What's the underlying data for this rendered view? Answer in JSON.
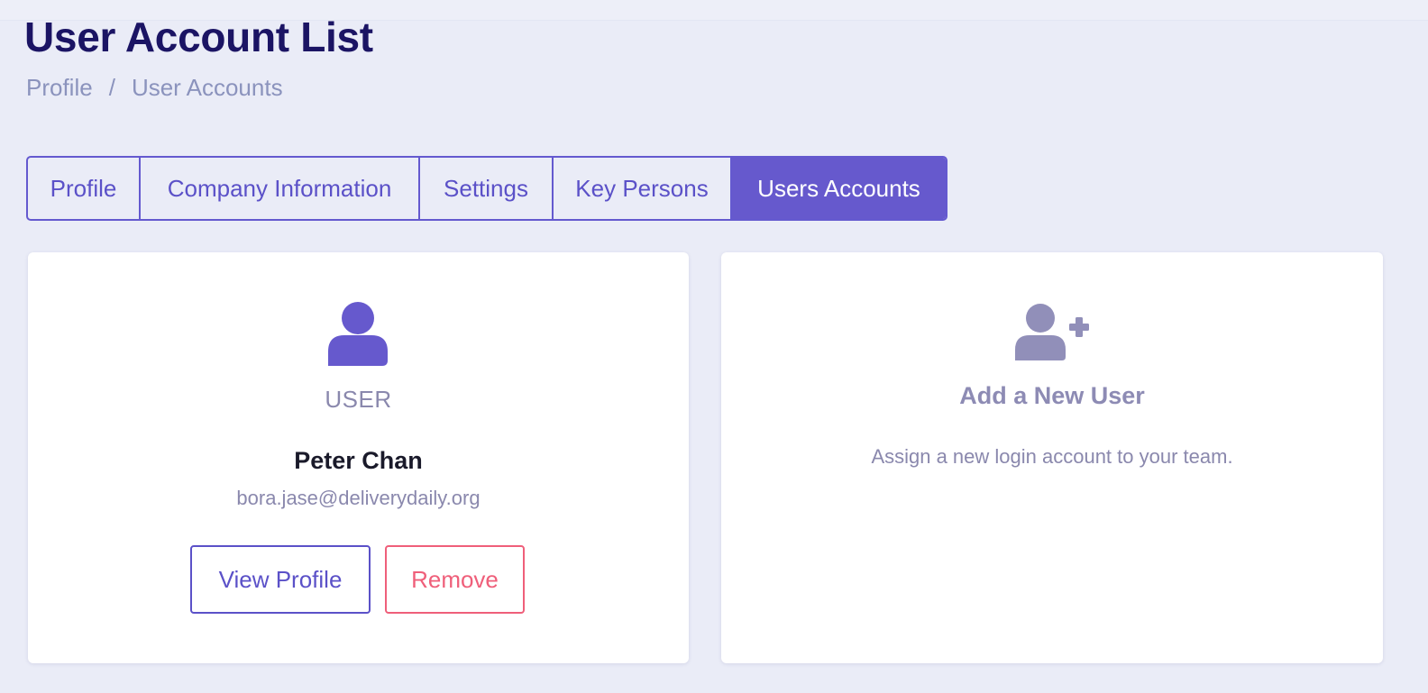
{
  "page": {
    "title": "User Account List"
  },
  "breadcrumb": {
    "items": [
      "Profile",
      "User Accounts"
    ],
    "separator": "/"
  },
  "tabs": [
    {
      "label": "Profile",
      "active": false
    },
    {
      "label": "Company Information",
      "active": false
    },
    {
      "label": "Settings",
      "active": false
    },
    {
      "label": "Key Persons",
      "active": false
    },
    {
      "label": "Users Accounts",
      "active": true
    }
  ],
  "user_card": {
    "icon": "user-icon",
    "role": "USER",
    "name": "Peter Chan",
    "email": "bora.jase@deliverydaily.org",
    "view_label": "View Profile",
    "remove_label": "Remove"
  },
  "add_card": {
    "icon": "user-plus-icon",
    "title": "Add a New User",
    "description": "Assign a new login account to your team."
  },
  "colors": {
    "accent": "#6659cd",
    "title": "#1b1464",
    "danger": "#ef5f7a",
    "background": "#eaecf7"
  }
}
